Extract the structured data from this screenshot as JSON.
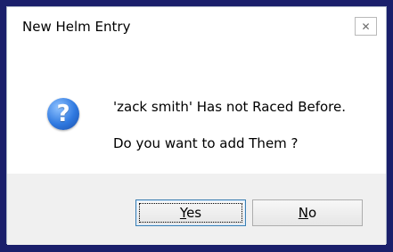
{
  "window": {
    "title": "New Helm Entry"
  },
  "message": {
    "line1": "'zack smith' Has not Raced Before.",
    "line2": "Do you want to add Them ?"
  },
  "icons": {
    "dialog_icon": "question-icon",
    "close_icon": "close-icon",
    "question_glyph": "?",
    "close_glyph": "✕"
  },
  "buttons": {
    "yes_label": "Yes",
    "no_label": "No"
  },
  "colors": {
    "frame": "#1a1f6b",
    "button_bar": "#f0f0f0",
    "icon_blue": "#2f79e0"
  }
}
